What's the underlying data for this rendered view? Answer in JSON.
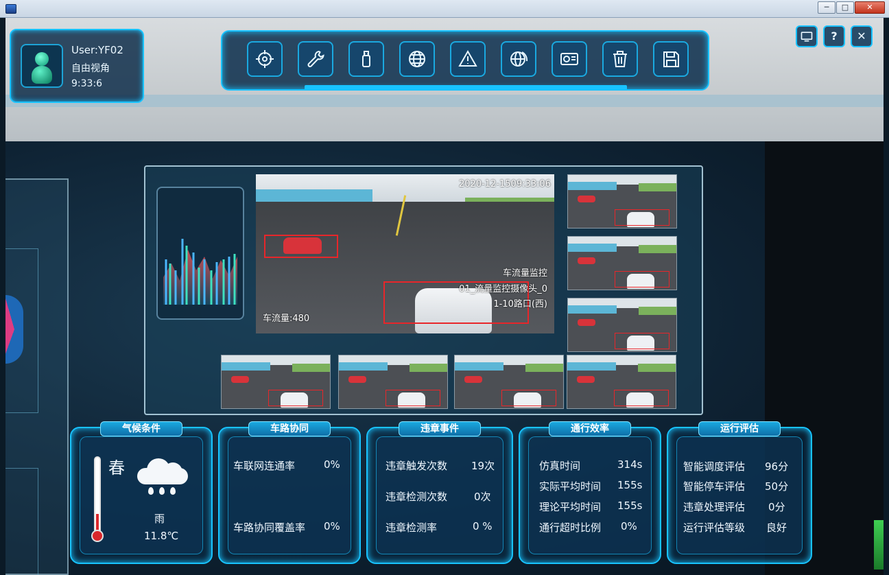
{
  "user": {
    "name": "User:YF02",
    "mode": "自由视角",
    "time": "9:33:6"
  },
  "toolbar": {
    "items": [
      {
        "name": "target-icon"
      },
      {
        "name": "wrench-icon"
      },
      {
        "name": "usb-icon"
      },
      {
        "name": "globe-icon"
      },
      {
        "name": "warning-icon"
      },
      {
        "name": "globe-network-icon"
      },
      {
        "name": "id-card-icon"
      },
      {
        "name": "trash-icon"
      },
      {
        "name": "save-icon"
      }
    ]
  },
  "top_right": {
    "help": "?",
    "close": "✕"
  },
  "window": {
    "minimize": "─",
    "maximize": "□",
    "close": "✕"
  },
  "video": {
    "timestamp": "2020-12-1509:33:06",
    "monitor_title": "车流量监控",
    "camera": "01_流量监控摄像头_0",
    "road": "1-10路口(西)",
    "flow_count": "车流量:480"
  },
  "panels": {
    "climate": {
      "title": "气候条件",
      "season": "春",
      "weather": "雨",
      "temperature": "11.8℃"
    },
    "v2x": {
      "title": "车路协同",
      "rows": [
        {
          "label": "车联网连通率",
          "value": "0%"
        },
        {
          "label": "车路协同覆盖率",
          "value": "0%"
        }
      ]
    },
    "violation": {
      "title": "违章事件",
      "rows": [
        {
          "label": "违章触发次数",
          "value": "19次"
        },
        {
          "label": "违章检测次数",
          "value": "0次"
        },
        {
          "label": "违章检测率",
          "value": "0 %"
        }
      ]
    },
    "efficiency": {
      "title": "通行效率",
      "rows": [
        {
          "label": "仿真时间",
          "value": "314s"
        },
        {
          "label": "实际平均时间",
          "value": "155s"
        },
        {
          "label": "理论平均时间",
          "value": "155s"
        },
        {
          "label": "通行超时比例",
          "value": "0%"
        }
      ]
    },
    "evaluation": {
      "title": "运行评估",
      "rows": [
        {
          "label": "智能调度评估",
          "value": "96分"
        },
        {
          "label": "智能停车评估",
          "value": "50分"
        },
        {
          "label": "违章处理评估",
          "value": "0分"
        },
        {
          "label": "运行评估等级",
          "value": "良好"
        }
      ]
    }
  }
}
